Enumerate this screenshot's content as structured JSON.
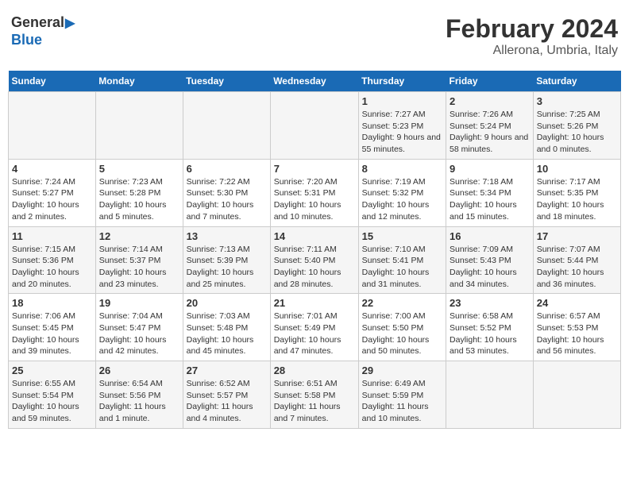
{
  "header": {
    "logo_line1": "General",
    "logo_line2": "Blue",
    "title": "February 2024",
    "subtitle": "Allerona, Umbria, Italy"
  },
  "columns": [
    "Sunday",
    "Monday",
    "Tuesday",
    "Wednesday",
    "Thursday",
    "Friday",
    "Saturday"
  ],
  "weeks": [
    [
      {
        "day": "",
        "info": ""
      },
      {
        "day": "",
        "info": ""
      },
      {
        "day": "",
        "info": ""
      },
      {
        "day": "",
        "info": ""
      },
      {
        "day": "1",
        "sunrise": "7:27 AM",
        "sunset": "5:23 PM",
        "daylight": "9 hours and 55 minutes."
      },
      {
        "day": "2",
        "sunrise": "7:26 AM",
        "sunset": "5:24 PM",
        "daylight": "9 hours and 58 minutes."
      },
      {
        "day": "3",
        "sunrise": "7:25 AM",
        "sunset": "5:26 PM",
        "daylight": "10 hours and 0 minutes."
      }
    ],
    [
      {
        "day": "4",
        "sunrise": "7:24 AM",
        "sunset": "5:27 PM",
        "daylight": "10 hours and 2 minutes."
      },
      {
        "day": "5",
        "sunrise": "7:23 AM",
        "sunset": "5:28 PM",
        "daylight": "10 hours and 5 minutes."
      },
      {
        "day": "6",
        "sunrise": "7:22 AM",
        "sunset": "5:30 PM",
        "daylight": "10 hours and 7 minutes."
      },
      {
        "day": "7",
        "sunrise": "7:20 AM",
        "sunset": "5:31 PM",
        "daylight": "10 hours and 10 minutes."
      },
      {
        "day": "8",
        "sunrise": "7:19 AM",
        "sunset": "5:32 PM",
        "daylight": "10 hours and 12 minutes."
      },
      {
        "day": "9",
        "sunrise": "7:18 AM",
        "sunset": "5:34 PM",
        "daylight": "10 hours and 15 minutes."
      },
      {
        "day": "10",
        "sunrise": "7:17 AM",
        "sunset": "5:35 PM",
        "daylight": "10 hours and 18 minutes."
      }
    ],
    [
      {
        "day": "11",
        "sunrise": "7:15 AM",
        "sunset": "5:36 PM",
        "daylight": "10 hours and 20 minutes."
      },
      {
        "day": "12",
        "sunrise": "7:14 AM",
        "sunset": "5:37 PM",
        "daylight": "10 hours and 23 minutes."
      },
      {
        "day": "13",
        "sunrise": "7:13 AM",
        "sunset": "5:39 PM",
        "daylight": "10 hours and 25 minutes."
      },
      {
        "day": "14",
        "sunrise": "7:11 AM",
        "sunset": "5:40 PM",
        "daylight": "10 hours and 28 minutes."
      },
      {
        "day": "15",
        "sunrise": "7:10 AM",
        "sunset": "5:41 PM",
        "daylight": "10 hours and 31 minutes."
      },
      {
        "day": "16",
        "sunrise": "7:09 AM",
        "sunset": "5:43 PM",
        "daylight": "10 hours and 34 minutes."
      },
      {
        "day": "17",
        "sunrise": "7:07 AM",
        "sunset": "5:44 PM",
        "daylight": "10 hours and 36 minutes."
      }
    ],
    [
      {
        "day": "18",
        "sunrise": "7:06 AM",
        "sunset": "5:45 PM",
        "daylight": "10 hours and 39 minutes."
      },
      {
        "day": "19",
        "sunrise": "7:04 AM",
        "sunset": "5:47 PM",
        "daylight": "10 hours and 42 minutes."
      },
      {
        "day": "20",
        "sunrise": "7:03 AM",
        "sunset": "5:48 PM",
        "daylight": "10 hours and 45 minutes."
      },
      {
        "day": "21",
        "sunrise": "7:01 AM",
        "sunset": "5:49 PM",
        "daylight": "10 hours and 47 minutes."
      },
      {
        "day": "22",
        "sunrise": "7:00 AM",
        "sunset": "5:50 PM",
        "daylight": "10 hours and 50 minutes."
      },
      {
        "day": "23",
        "sunrise": "6:58 AM",
        "sunset": "5:52 PM",
        "daylight": "10 hours and 53 minutes."
      },
      {
        "day": "24",
        "sunrise": "6:57 AM",
        "sunset": "5:53 PM",
        "daylight": "10 hours and 56 minutes."
      }
    ],
    [
      {
        "day": "25",
        "sunrise": "6:55 AM",
        "sunset": "5:54 PM",
        "daylight": "10 hours and 59 minutes."
      },
      {
        "day": "26",
        "sunrise": "6:54 AM",
        "sunset": "5:56 PM",
        "daylight": "11 hours and 1 minute."
      },
      {
        "day": "27",
        "sunrise": "6:52 AM",
        "sunset": "5:57 PM",
        "daylight": "11 hours and 4 minutes."
      },
      {
        "day": "28",
        "sunrise": "6:51 AM",
        "sunset": "5:58 PM",
        "daylight": "11 hours and 7 minutes."
      },
      {
        "day": "29",
        "sunrise": "6:49 AM",
        "sunset": "5:59 PM",
        "daylight": "11 hours and 10 minutes."
      },
      {
        "day": "",
        "info": ""
      },
      {
        "day": "",
        "info": ""
      }
    ]
  ],
  "labels": {
    "sunrise_prefix": "Sunrise: ",
    "sunset_prefix": "Sunset: ",
    "daylight_prefix": "Daylight: "
  }
}
